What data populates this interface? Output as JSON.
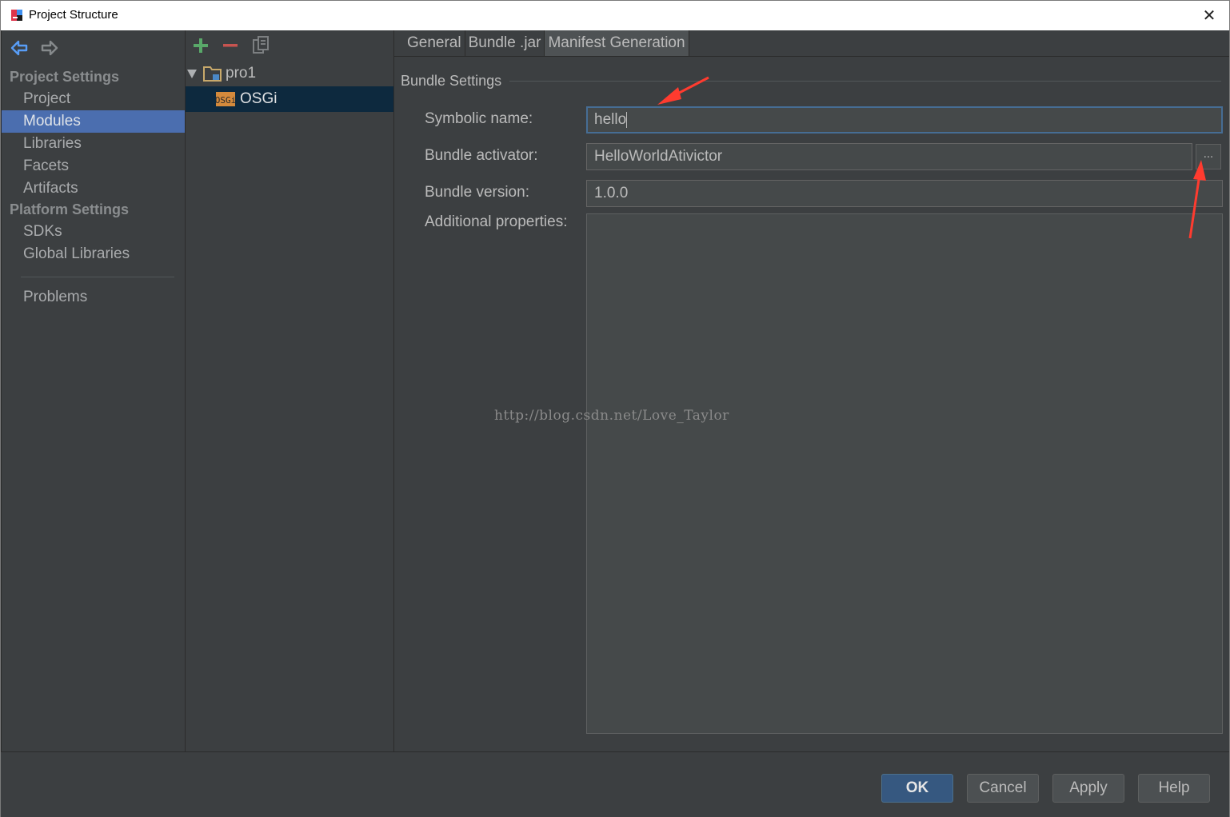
{
  "window": {
    "title": "Project Structure",
    "close": "✕"
  },
  "sidebar": {
    "project_settings": "Project Settings",
    "platform_settings": "Platform Settings",
    "items": {
      "project": "Project",
      "modules": "Modules",
      "libraries": "Libraries",
      "facets": "Facets",
      "artifacts": "Artifacts",
      "sdks": "SDKs",
      "global_libraries": "Global Libraries",
      "problems": "Problems"
    },
    "selected": "Modules"
  },
  "tree": {
    "root": "pro1",
    "child": "OSGi",
    "child_badge": "OSGi"
  },
  "tabs": {
    "general": "General",
    "bundle_jar": "Bundle .jar",
    "manifest_generation": "Manifest Generation",
    "active": "Manifest Generation"
  },
  "form": {
    "section_title": "Bundle Settings",
    "symbolic_name_label": "Symbolic name:",
    "symbolic_name_value": "hello",
    "bundle_activator_label": "Bundle activator:",
    "bundle_activator_value": "HelloWorldAtivictor",
    "browse_label": "...",
    "bundle_version_label": "Bundle version:",
    "bundle_version_value": "1.0.0",
    "additional_properties_label": "Additional properties:"
  },
  "watermark": "http://blog.csdn.net/Love_Taylor",
  "buttons": {
    "ok": "OK",
    "cancel": "Cancel",
    "apply": "Apply",
    "help": "Help"
  },
  "colors": {
    "accent_selected": "#4b6eaf",
    "add_green": "#59a869",
    "remove_red": "#c75450",
    "annotation_red": "#ff3b2f"
  },
  "icons": {
    "back": "back-arrow-icon",
    "forward": "forward-arrow-icon",
    "add": "plus-icon",
    "remove": "minus-icon",
    "copy": "copy-icon",
    "folder": "module-folder-icon",
    "osgi": "osgi-facet-icon",
    "expand": "triangle-down-icon"
  }
}
